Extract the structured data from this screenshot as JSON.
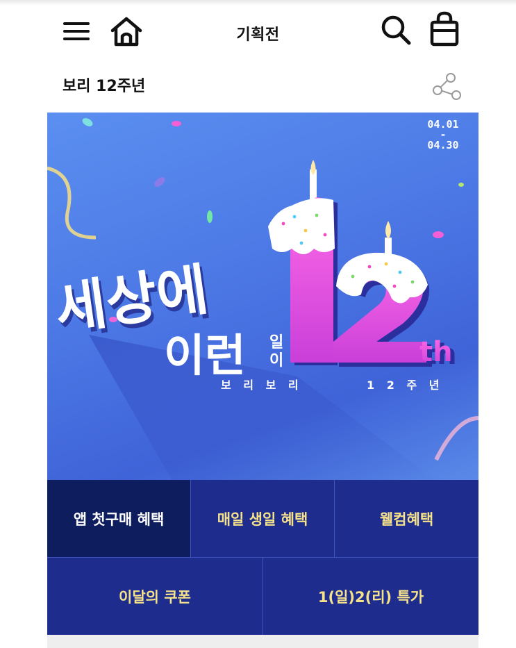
{
  "header": {
    "title": "기획전",
    "icons": [
      "menu-icon",
      "home-icon",
      "search-icon",
      "shopping-bag-icon"
    ]
  },
  "page": {
    "title": "보리 12주년",
    "share_icon": "share-icon"
  },
  "banner": {
    "date_start": "04.01",
    "date_sep": "-",
    "date_end": "04.30",
    "headline_line1": "세상에",
    "headline_line2": "이런",
    "headline_small_1": "일",
    "headline_small_2": "이",
    "big_number": "12",
    "suffix": "th",
    "tagline_left": "보 리 보 리",
    "tagline_right": "1 2 주 년"
  },
  "benefits": [
    {
      "label": "앱 첫구매 혜택",
      "active": true
    },
    {
      "label": "매일 생일 혜택",
      "active": false
    },
    {
      "label": "웰컴혜택",
      "active": false
    },
    {
      "label": "이달의 쿠폰",
      "active": false
    },
    {
      "label": "1(일)2(리) 특가",
      "active": false
    }
  ],
  "colors": {
    "banner_blue": "#4d7ae6",
    "benefit_bg": "#1f2d8c",
    "benefit_active_bg": "#0e1d5e",
    "benefit_text": "#f6e28a",
    "number_pink": "#e04fd0"
  }
}
